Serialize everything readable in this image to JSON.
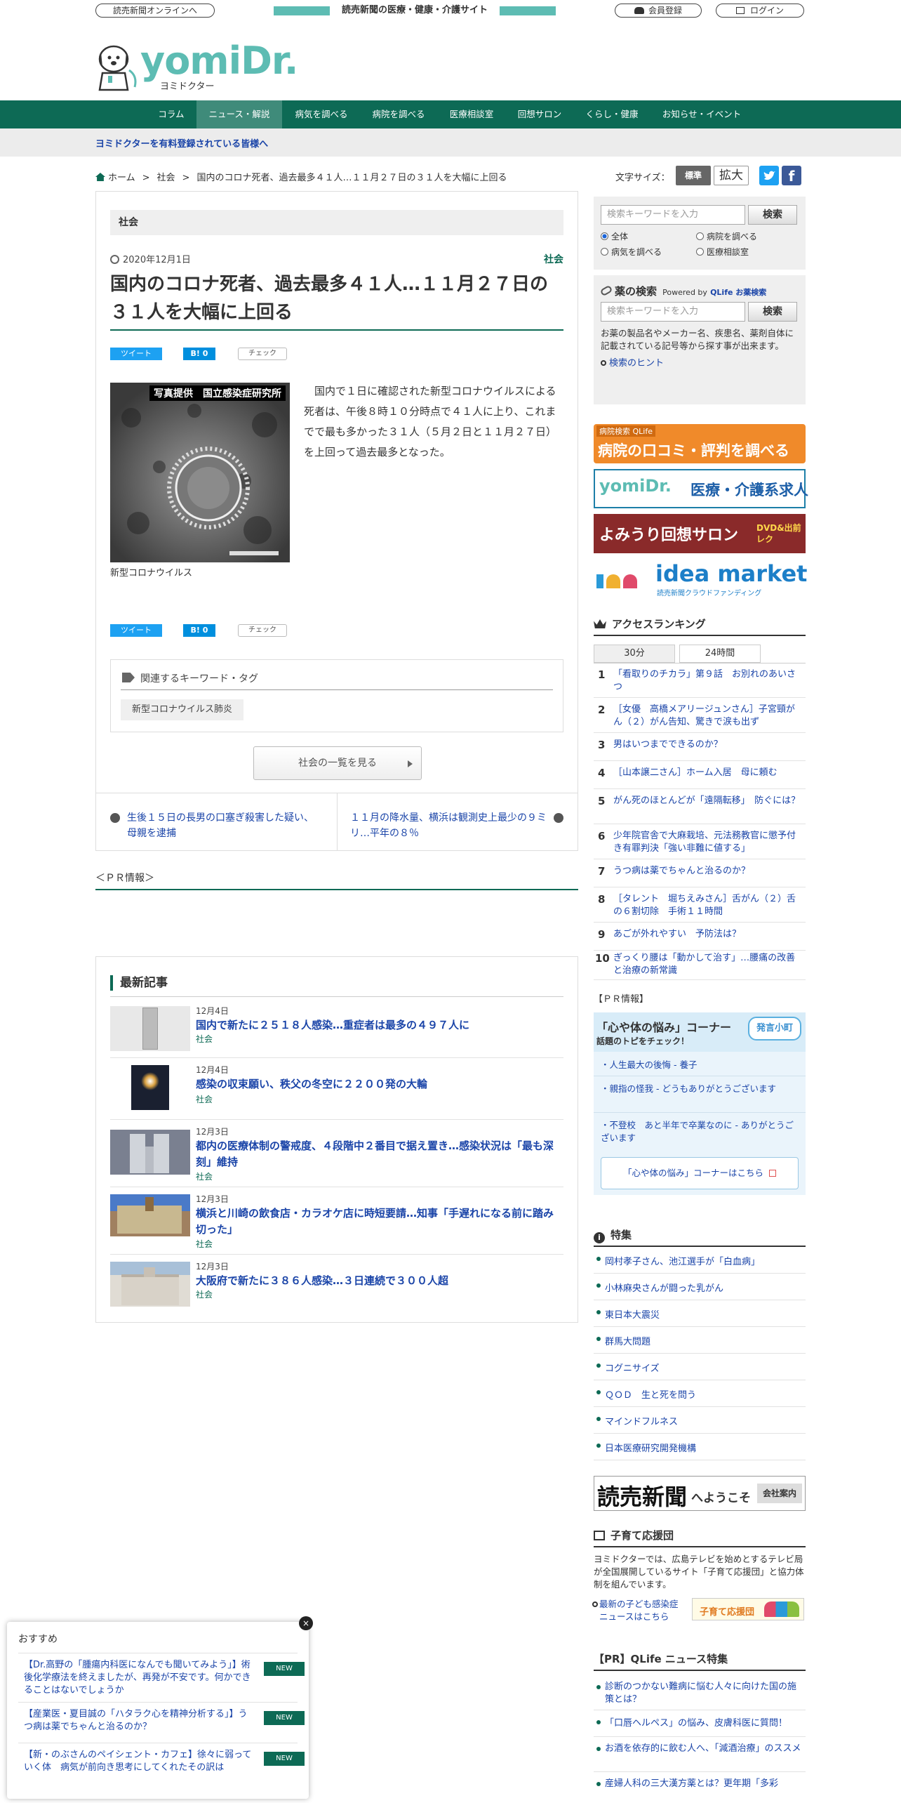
{
  "header": {
    "online_link": "読売新聞オンラインへ",
    "tagline": "読売新聞の医療・健康・介護サイト",
    "register": "会員登録",
    "login": "ログイン",
    "logo_main": "yomiDr.",
    "logo_sub": "ヨミドクター"
  },
  "nav": [
    "コラム",
    "ニュース・解説",
    "病気を調べる",
    "病院を調べる",
    "医療相談室",
    "回想サロン",
    "くらし・健康",
    "お知らせ・イベント"
  ],
  "notice": "ヨミドクターを有料登録されている皆様へ",
  "breadcrumb": {
    "home": "ホーム",
    "category": "社会",
    "sep": ">",
    "current": "国内のコロナ死者、過去最多４１人…１１月２７日の３１人を大幅に上回る"
  },
  "font_size": {
    "label": "文字サイズ：",
    "standard": "標準",
    "large": "拡大"
  },
  "article": {
    "section": "社会",
    "date": "2020年12月1日",
    "category": "社会",
    "title": "国内のコロナ死者、過去最多４１人…１１月２７日の３１人を大幅に上回る",
    "share": {
      "tweet": "ツイート",
      "hatena": "B! 0",
      "check": "チェック"
    },
    "photo_credit": "写真提供　国立感染症研究所",
    "photo_caption": "新型コロナウイルス",
    "body": "国内で１日に確認された新型コロナウイルスによる死者は、午後８時１０分時点で４１人に上り、これまでで最も多かった３１人（５月２日と１１月２７日）を上回って過去最多となった。",
    "tags_title": "関連するキーワード・タグ",
    "tag": "新型コロナウイルス肺炎",
    "more_button": "社会の一覧を見る",
    "prev": "生後１５日の長男の口塞ぎ殺害した疑い、母親を逮捕",
    "next": "１１月の降水量、横浜は観測史上最少の９ミリ…平年の８％"
  },
  "pr_info": "＜ＰＲ情報＞",
  "latest": {
    "title": "最新記事",
    "items": [
      {
        "date": "12月4日",
        "title": "国内で新たに２５１８人感染…重症者は最多の４９７人に",
        "cat": "社会"
      },
      {
        "date": "12月4日",
        "title": "感染の収束願い、秩父の冬空に２２００発の大輪",
        "cat": "社会"
      },
      {
        "date": "12月3日",
        "title": "都内の医療体制の警戒度、４段階中２番目で据え置き…感染状況は「最も深刻」維持",
        "cat": "社会"
      },
      {
        "date": "12月3日",
        "title": "横浜と川崎の飲食店・カラオケ店に時短要請…知事「手遅れになる前に踏み切った」",
        "cat": "社会"
      },
      {
        "date": "12月3日",
        "title": "大阪府で新たに３８６人感染…３日連続で３００人超",
        "cat": "社会"
      }
    ]
  },
  "sidebar": {
    "search": {
      "placeholder": "検索キーワードを入力",
      "button": "検索",
      "options": [
        "全体",
        "病院を調べる",
        "病気を調べる",
        "医療相談室"
      ]
    },
    "drug": {
      "title": "薬の検索",
      "powered": "Powered by",
      "powered_link": "QLife お薬検索",
      "placeholder": "検索キーワードを入力",
      "button": "検索",
      "desc": "お薬の製品名やメーカー名、疾患名、薬剤自体に記載されている記号等から探す事が出来ます。",
      "hint": "検索のヒント"
    },
    "banners": {
      "b1_small": "病院検索 QLife",
      "b1_main": "病院の口コミ・評判を調べる",
      "b2_logo": "yomiDr.",
      "b2_main": "医療・介護系求人",
      "b3_main": "よみうり回想サロン",
      "b3_sub": "DVD&出前レク",
      "b4_main": "idea market",
      "b4_sub": "読売新聞クラウドファンディング"
    },
    "ranking": {
      "title": "アクセスランキング",
      "tabs": [
        "30分",
        "24時間"
      ],
      "items": [
        "「看取りのチカラ」第９話　お別れのあいさつ",
        "［女優　高橋メアリージュンさん］子宮頸がん（２）がん告知、驚きで涙も出ず",
        "男はいつまでできるのか？",
        "［山本譲二さん］ホーム入居　母に頼む",
        "がん死のほとんどが「遠隔転移」　防ぐには？",
        "少年院官舎で大麻栽培、元法務教官に懲予付き有罪判決「強い非難に値する」",
        "うつ病は薬でちゃんと治るのか？",
        "［タレント　堀ちえみさん］舌がん（２）舌の６割切除　手術１１時間",
        "あごが外れやすい　予防法は？",
        "ぎっくり腰は「動かして治す」…腰痛の改善と治療の新常識"
      ]
    },
    "pr": {
      "label": "【ＰＲ情報】",
      "corner_title": "「心や体の悩み」コーナー",
      "corner_sub": "話題のトピをチェック！",
      "badge": "発言小町",
      "items": [
        "人生最大の後悔 - 養子",
        "親指の怪我 - どうもありがとうございます",
        "不登校　あと半年で卒業なのに - ありがとうございます"
      ],
      "link": "「心や体の悩み」コーナーはこちら"
    },
    "features": {
      "title": "特集",
      "items": [
        "岡村孝子さん、池江選手が「白血病」",
        "小林麻央さんが闘った乳がん",
        "東日本大震災",
        "群馬大問題",
        "コグニサイズ",
        "ＱＯＤ　生と死を問う",
        "マインドフルネス",
        "日本医療研究開発機構"
      ]
    },
    "yomiuri": {
      "main": "読売新聞",
      "sub": "へようこそ",
      "btn": "会社案内"
    },
    "kosodate": {
      "title": "子育て応援団",
      "desc": "ヨミドクターでは、広島テレビを始めとするテレビ局が全国展開しているサイト「子育て応援団」と協力体制を組んでいます。",
      "link": "最新の子ども感染症ニュースはこちら",
      "banner": "子育て応援団"
    },
    "qlife": {
      "title": "【PR】QLife ニュース特集",
      "items": [
        "診断のつかない難病に悩む人々に向けた国の施策とは？",
        "「口唇ヘルペス」の悩み、皮膚科医に質問！",
        "お酒を依存的に飲む人へ、「減酒治療」のススメ",
        "産婦人科の三大漢方薬とは？更年期「多彩"
      ]
    }
  },
  "popup": {
    "title": "おすすめ",
    "close": "×",
    "new_label": "NEW",
    "items": [
      "【Dr.高野の「腫瘍内科医になんでも聞いてみよう」】術後化学療法を終えましたが、再発が不安です。何かできることはないでしょうか",
      "【産業医・夏目誠の「ハタラク心を精神分析する」】うつ病は薬でちゃんと治るのか？",
      "【新・のぶさんのペイシェント・カフェ】徐々に弱っていく体　病気が前向き思考にしてくれたその訳は"
    ]
  }
}
